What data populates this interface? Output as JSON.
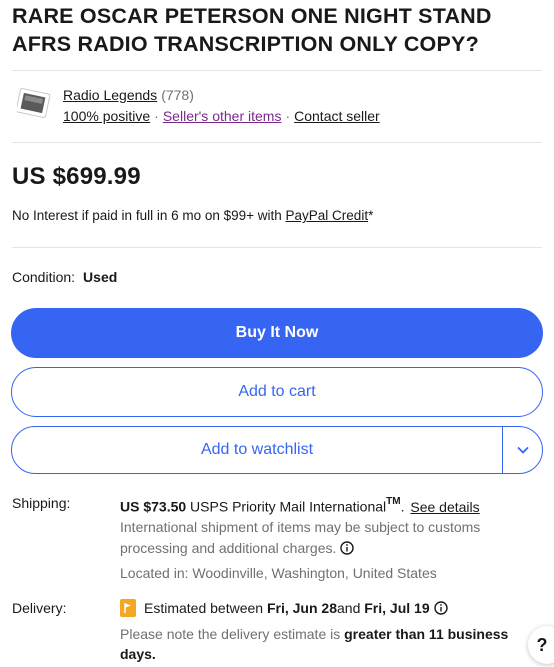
{
  "title": "RARE OSCAR PETERSON ONE NIGHT STAND AFRS RADIO TRANSCRIPTION ONLY COPY?",
  "seller": {
    "name": "Radio Legends",
    "feedback_count": "(778)",
    "positive": "100% positive",
    "other_items": "Seller's other items",
    "contact": "Contact seller",
    "separator": "·"
  },
  "price": "US $699.99",
  "finance": {
    "text": "No Interest if paid in full in 6 mo on $99+ with ",
    "link": "PayPal Credit",
    "suffix": "*"
  },
  "condition": {
    "label": "Condition:",
    "value": "Used"
  },
  "buttons": {
    "buy_now": "Buy It Now",
    "add_to_cart": "Add to cart",
    "add_to_watchlist": "Add to watchlist"
  },
  "shipping": {
    "label": "Shipping:",
    "price": "US $73.50",
    "service": " USPS Priority Mail International",
    "tm": "TM",
    "period": ".",
    "see_details": "See details",
    "note": "International shipment of items may be subject to customs processing and additional charges.",
    "located": "Located in: Woodinville, Washington, United States"
  },
  "delivery": {
    "label": "Delivery:",
    "prefix": "Estimated between ",
    "start": "Fri, Jun 28",
    "and": " and ",
    "end": "Fri, Jul 19",
    "note_prefix": "Please note the delivery estimate is ",
    "note_bold": "greater than 11 business days."
  },
  "help": "?",
  "colors": {
    "accent": "#3665f3",
    "text": "#191919",
    "muted": "#707070",
    "visited_link": "#7a2a8a",
    "delivery_flag": "#f5a623"
  },
  "icons": [
    "seller-avatar-icon",
    "info-icon",
    "chevron-down-icon",
    "delivery-flag-icon"
  ]
}
